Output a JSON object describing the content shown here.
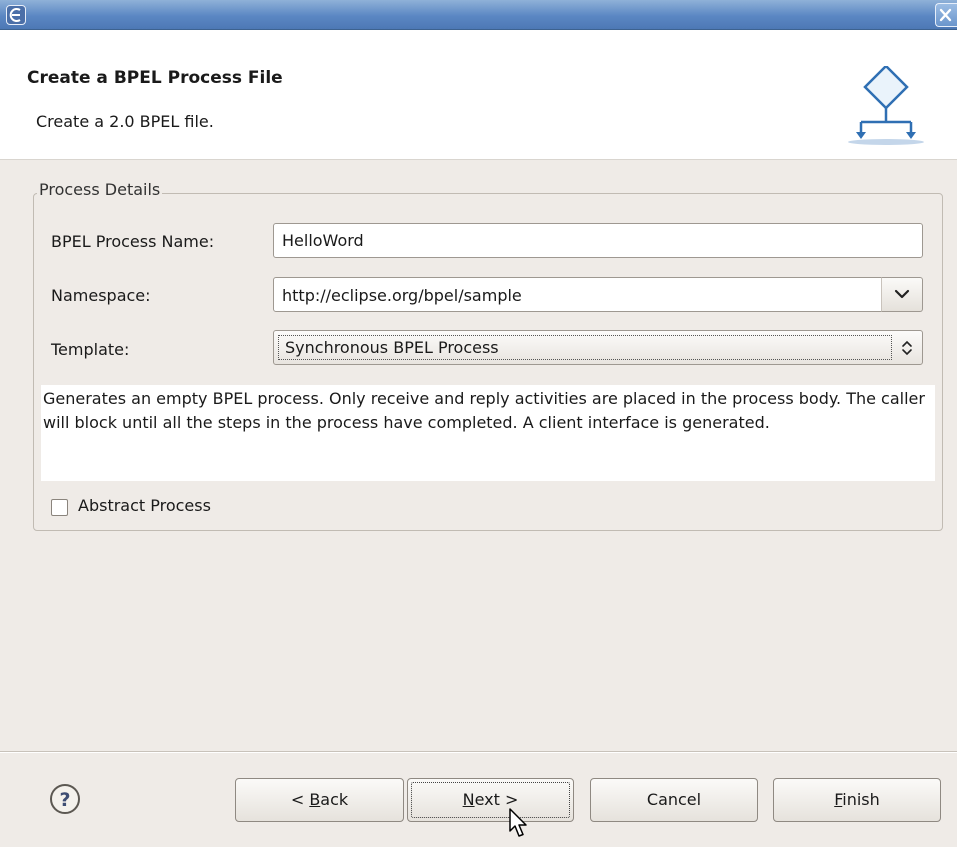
{
  "header": {
    "title": "Create a BPEL Process File",
    "description": "Create a 2.0 BPEL file."
  },
  "group": {
    "legend": "Process Details"
  },
  "form": {
    "process_name_label": "BPEL Process Name:",
    "process_name_value": "HelloWord",
    "namespace_label": "Namespace:",
    "namespace_value": "http://eclipse.org/bpel/sample",
    "template_label": "Template:",
    "template_value": "Synchronous BPEL Process",
    "template_description": "Generates an empty BPEL process. Only receive and reply activities are placed in the process body. The caller will block until all the steps in the process have completed. A client interface is generated.",
    "abstract_label": "Abstract Process",
    "abstract_checked": false
  },
  "buttons": {
    "back": {
      "prefix": "< ",
      "mnemonic": "B",
      "rest": "ack"
    },
    "next": {
      "mnemonic": "N",
      "rest": "ext >"
    },
    "cancel": "Cancel",
    "finish": {
      "mnemonic": "F",
      "rest": "inish"
    }
  },
  "icons": {
    "window": "eclipse-window-icon",
    "close": "close-icon",
    "wizard_banner": "bpel-process-icon",
    "dropdown": "chevron-down-icon",
    "spinner": "up-down-spinner-icon",
    "help": "help-icon",
    "cursor": "mouse-pointer-icon"
  },
  "colors": {
    "titlebar": "#5b87c3",
    "dialog_background": "#efebe7",
    "banner_icon": "#2f6fb3"
  }
}
